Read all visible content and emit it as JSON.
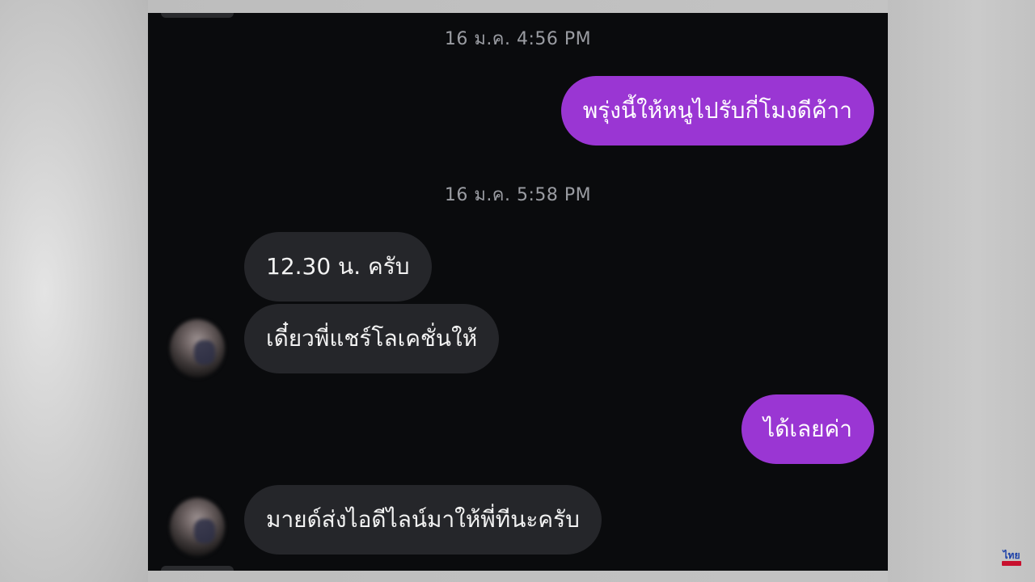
{
  "conversation": {
    "messages": [
      {
        "type": "timestamp",
        "text": "16 ม.ค. 4:56 PM"
      },
      {
        "type": "sent",
        "text": "พรุ่งนี้ให้หนูไปรับกี่โมงดีค้าา"
      },
      {
        "type": "timestamp",
        "text": "16 ม.ค. 5:58 PM"
      },
      {
        "type": "received",
        "text": "12.30 น. ครับ"
      },
      {
        "type": "received",
        "text": "เดี๋ยวพี่แชร์โลเคชั่นให้"
      },
      {
        "type": "sent",
        "text": "ได้เลยค่า"
      },
      {
        "type": "received",
        "text": "มายด์ส่งไอดีไลน์มาให้พี่ทีนะครับ"
      }
    ]
  },
  "colors": {
    "sent_bubble": "#9a36d3",
    "received_bubble": "#25262a",
    "chat_background": "#0a0b0d",
    "timestamp_text": "#9a9ca2"
  },
  "watermark": {
    "text": "ไทย"
  }
}
